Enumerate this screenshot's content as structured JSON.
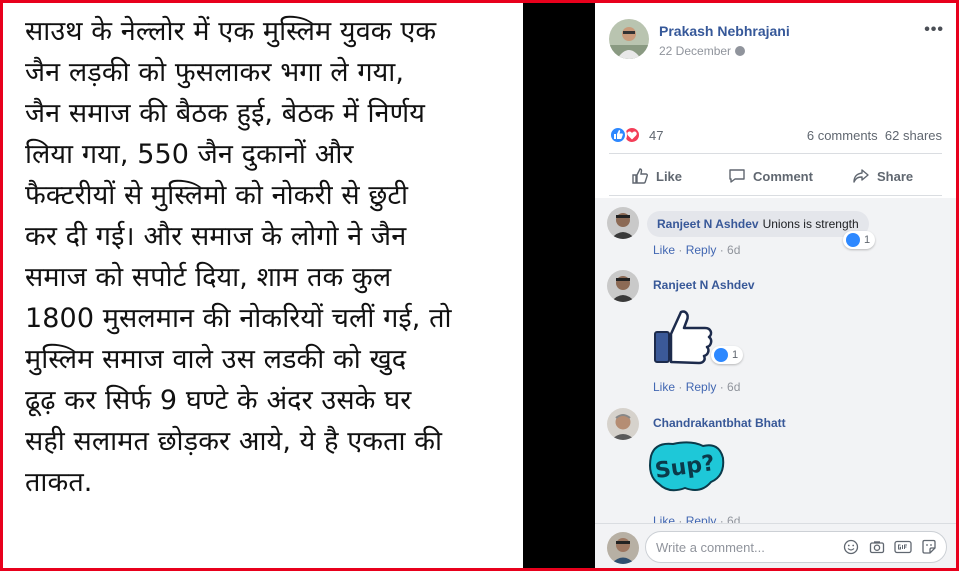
{
  "post_image": {
    "lines": [
      "साउथ के नेल्लोर में एक मुस्लिम युवक एक",
      "जैन लड़की को फुसलाकर भगा ले गया,",
      "जैन समाज की बैठक हुई, बेठक में निर्णय",
      "लिया गया, 550 जैन दुकानों और",
      "फैक्टरीयों से मुस्लिमो को  नोकरी से छुटी",
      "कर दी गई। और समाज के लोगो ने जैन",
      "समाज को सपोर्ट दिया, शाम तक कुल",
      "1800 मुसलमान की नोकरियों चलीं गई, तो",
      "मुस्लिम समाज वाले उस लडकी को खुद",
      "ढूढ़ कर सिर्फ 9 घण्टे के अंदर उसके घर",
      "सही सलामत छोड़कर आये, ये है एकता की",
      "ताकत."
    ]
  },
  "post": {
    "author": "Prakash Nebhrajani",
    "date": "22 December",
    "more_icon": "ellipsis-icon",
    "reaction_count": "47",
    "comments_count": "6 comments",
    "shares_count": "62 shares"
  },
  "actions": {
    "like": "Like",
    "comment": "Comment",
    "share": "Share"
  },
  "comments": [
    {
      "name": "Ranjeet N Ashdev",
      "text": "Unions is strength",
      "reactions": "1",
      "like": "Like",
      "reply": "Reply",
      "time": "6d"
    },
    {
      "name": "Ranjeet N Ashdev",
      "sticker": "thumbs-up-sticker",
      "reactions": "1",
      "like": "Like",
      "reply": "Reply",
      "time": "6d"
    },
    {
      "name": "Chandrakantbhat Bhatt",
      "sticker": "sup-sticker",
      "sticker_text": "Sup?",
      "like": "Like",
      "reply": "Reply",
      "time": "6d"
    }
  ],
  "write_comment": {
    "placeholder": "Write a comment..."
  },
  "colors": {
    "frame": "#e8001c",
    "link": "#385898",
    "like_blue": "#2d88ff",
    "love_red": "#f33e58",
    "sticker_teal": "#1ec8d8"
  }
}
